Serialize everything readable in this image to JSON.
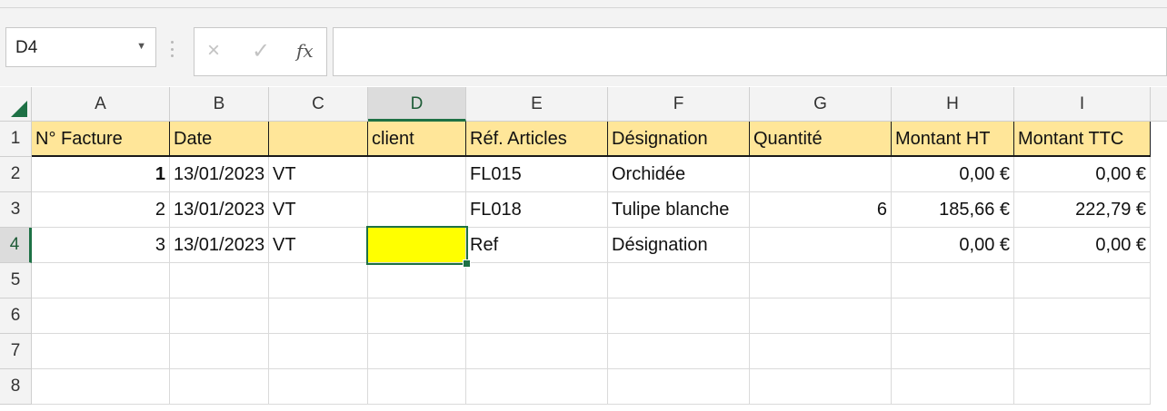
{
  "name_box": {
    "value": "D4"
  },
  "formula_bar": {
    "cancel_icon": "×",
    "enter_icon": "✓",
    "fx_label": "fx",
    "content": ""
  },
  "columns": [
    "A",
    "B",
    "C",
    "D",
    "E",
    "F",
    "G",
    "H",
    "I"
  ],
  "rows": [
    "1",
    "2",
    "3",
    "4",
    "5",
    "6",
    "7",
    "8"
  ],
  "active_cell": {
    "column": "D",
    "row": "4"
  },
  "header_fill": "#ffe699",
  "highlight_fill": "#ffff00",
  "cells": {
    "r1": [
      "N° Facture",
      "Date",
      "",
      "client",
      "Réf. Articles",
      "Désignation",
      "Quantité",
      "Montant HT",
      "Montant TTC"
    ],
    "r2": [
      "1",
      "13/01/2023",
      "VT",
      "",
      "FL015",
      "Orchidée",
      "",
      "0,00 €",
      "0,00 €"
    ],
    "r3": [
      "2",
      "13/01/2023",
      "VT",
      "",
      "FL018",
      "Tulipe blanche",
      "6",
      "185,66 €",
      "222,79 €"
    ],
    "r4": [
      "3",
      "13/01/2023",
      "VT",
      "",
      "Ref",
      "Désignation",
      "",
      "0,00 €",
      "0,00 €"
    ]
  }
}
